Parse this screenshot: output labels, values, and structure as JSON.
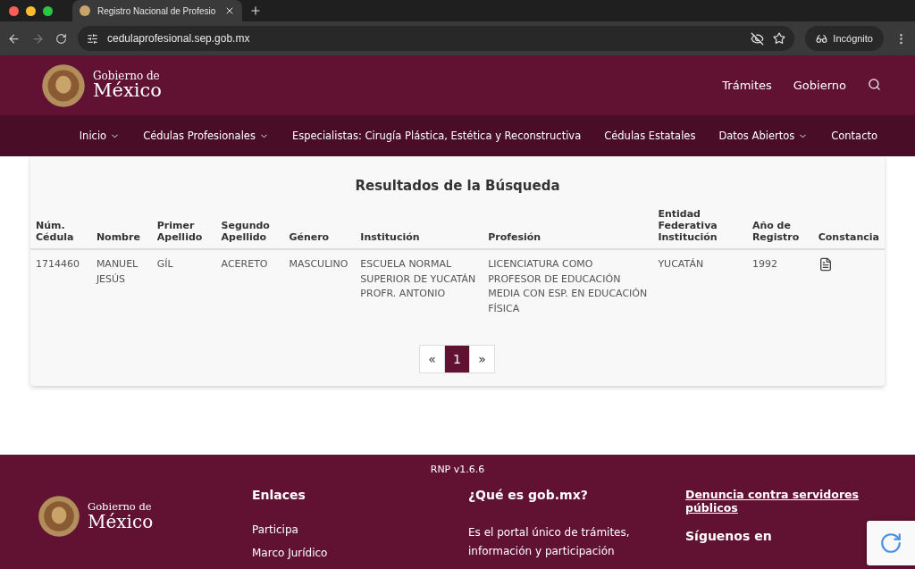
{
  "browser": {
    "tab_title": "Registro Nacional de Profesio",
    "url": "cedulaprofesional.sep.gob.mx",
    "profile": "Incógnito"
  },
  "header": {
    "logo_top": "Gobierno de",
    "logo_bottom": "México",
    "links": [
      "Trámites",
      "Gobierno"
    ]
  },
  "nav": [
    {
      "label": "Inicio",
      "dropdown": true
    },
    {
      "label": "Cédulas Profesionales",
      "dropdown": true
    },
    {
      "label": "Especialistas: Cirugía Plástica, Estética y Reconstructiva",
      "dropdown": false
    },
    {
      "label": "Cédulas Estatales",
      "dropdown": false
    },
    {
      "label": "Datos Abiertos",
      "dropdown": true
    },
    {
      "label": "Contacto",
      "dropdown": false
    }
  ],
  "results": {
    "title": "Resultados de la Búsqueda",
    "columns": [
      "Núm. Cédula",
      "Nombre",
      "Primer Apellido",
      "Segundo Apellido",
      "Género",
      "Institución",
      "Profesión",
      "Entidad Federativa Institución",
      "Año de Registro",
      "Constancia"
    ],
    "rows": [
      [
        "1714460",
        "MANUEL JESÚS",
        "GÍL",
        "ACERETO",
        "MASCULINO",
        "ESCUELA NORMAL SUPERIOR DE YUCATÁN PROFR. ANTONIO",
        "LICENCIATURA COMO PROFESOR DE EDUCACIÓN MEDIA CON ESP. EN EDUCACIÓN FÍSICA",
        "YUCATÁN",
        "1992"
      ]
    ],
    "pagination": {
      "prev": "«",
      "next": "»",
      "pages": [
        {
          "label": "1",
          "selected": true
        }
      ]
    }
  },
  "footer": {
    "version": "RNP v1.6.6",
    "logo_top": "Gobierno de",
    "logo_bottom": "México",
    "links_title": "Enlaces",
    "links": [
      "Participa",
      "Marco Jurídico"
    ],
    "about_title": "¿Qué es gob.mx?",
    "about_text": "Es el portal único de trámites, información y participación",
    "report_link": "Denuncia contra servidores públicos",
    "follow_title": "Síguenos en"
  }
}
